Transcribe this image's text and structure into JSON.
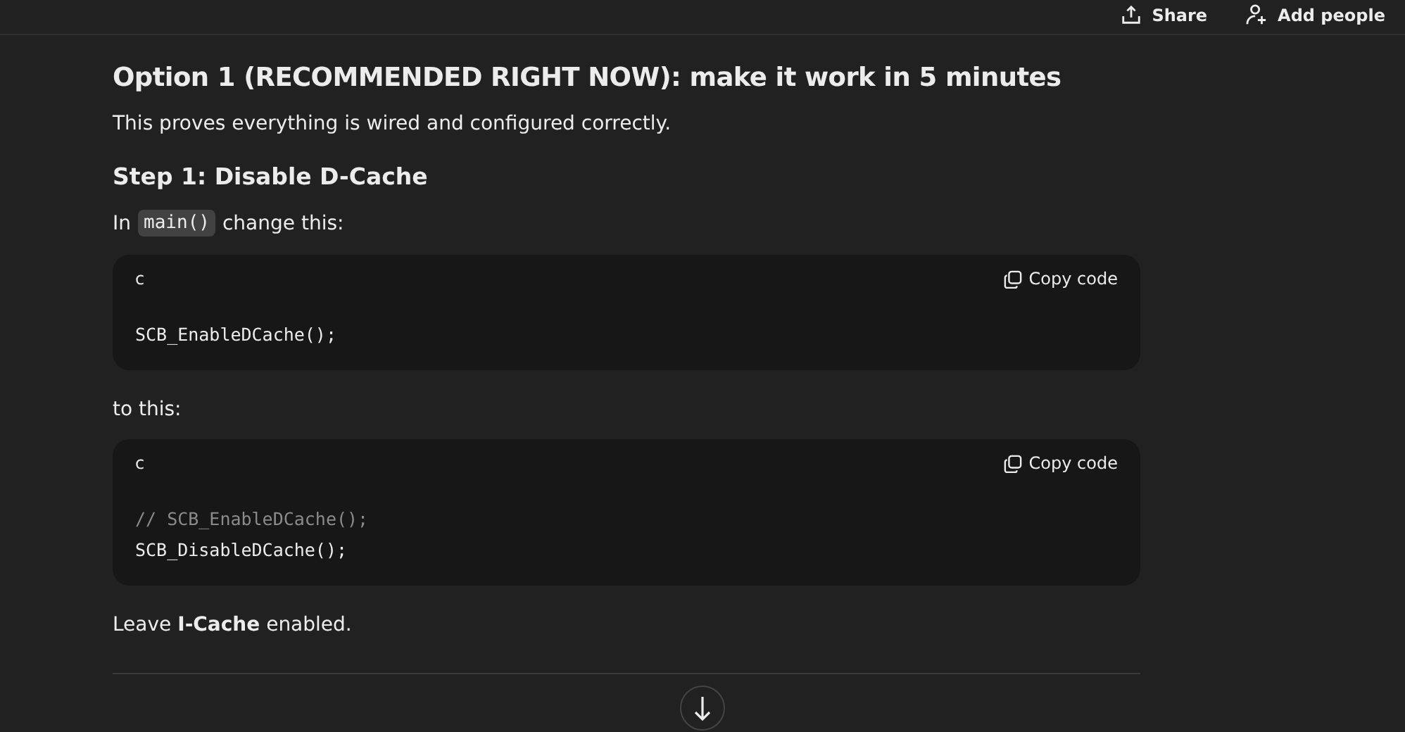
{
  "header": {
    "actions": [
      {
        "kind": "share",
        "label": "Share"
      },
      {
        "kind": "add-people",
        "label": "Add people"
      }
    ]
  },
  "content": [
    {
      "kind": "h2",
      "text": "Option 1 (RECOMMENDED RIGHT NOW): make it work in 5 minutes"
    },
    {
      "kind": "p",
      "text": "This proves everything is wired and configured correctly."
    },
    {
      "kind": "h3",
      "text": "Step 1: Disable D-Cache"
    },
    {
      "kind": "p-code",
      "before": "In",
      "code": "main()",
      "after": "change this:"
    },
    {
      "kind": "code",
      "language": "c",
      "copy_label": "Copy code",
      "lines": [
        {
          "kind": "code",
          "text": "SCB_EnableDCache();"
        }
      ]
    },
    {
      "kind": "p",
      "text": "to this:"
    },
    {
      "kind": "code",
      "language": "c",
      "copy_label": "Copy code",
      "lines": [
        {
          "kind": "comment",
          "text": "// SCB_EnableDCache();"
        },
        {
          "kind": "code",
          "text": "SCB_DisableDCache();"
        }
      ]
    },
    {
      "kind": "p",
      "text": "Leave **I-Cache** enabled."
    }
  ]
}
